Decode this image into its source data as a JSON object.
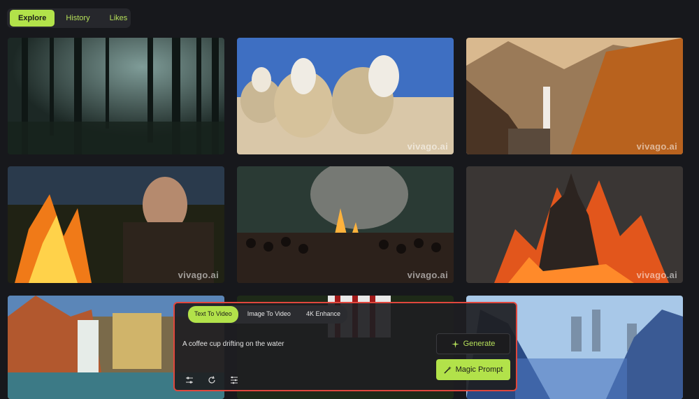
{
  "nav": {
    "tabs": [
      {
        "label": "Explore",
        "active": true
      },
      {
        "label": "History",
        "active": false
      },
      {
        "label": "Likes",
        "active": false
      }
    ]
  },
  "watermark": "vivago.ai",
  "gallery": [
    {
      "scene": "misty forest"
    },
    {
      "scene": "sheep on beach"
    },
    {
      "scene": "mountain waterfall canyon"
    },
    {
      "scene": "old man by campfire"
    },
    {
      "scene": "crowd at bonfire"
    },
    {
      "scene": "burning castle"
    },
    {
      "scene": "waterfalls autumn"
    },
    {
      "scene": "striped fabric"
    },
    {
      "scene": "robot city"
    }
  ],
  "prompt_panel": {
    "modes": [
      {
        "label": "Text To Video",
        "active": true
      },
      {
        "label": "Image To Video",
        "active": false
      },
      {
        "label": "4K Enhance",
        "active": false
      }
    ],
    "prompt_text": "A coffee cup drifting on the water",
    "generate_label": "Generate",
    "magic_prompt_label": "Magic Prompt",
    "tool_icons": [
      "sliders-icon",
      "refresh-icon",
      "settings-icon"
    ]
  },
  "colors": {
    "accent": "#b2e24a",
    "highlight_border": "#e0473d",
    "background": "#17181c"
  }
}
